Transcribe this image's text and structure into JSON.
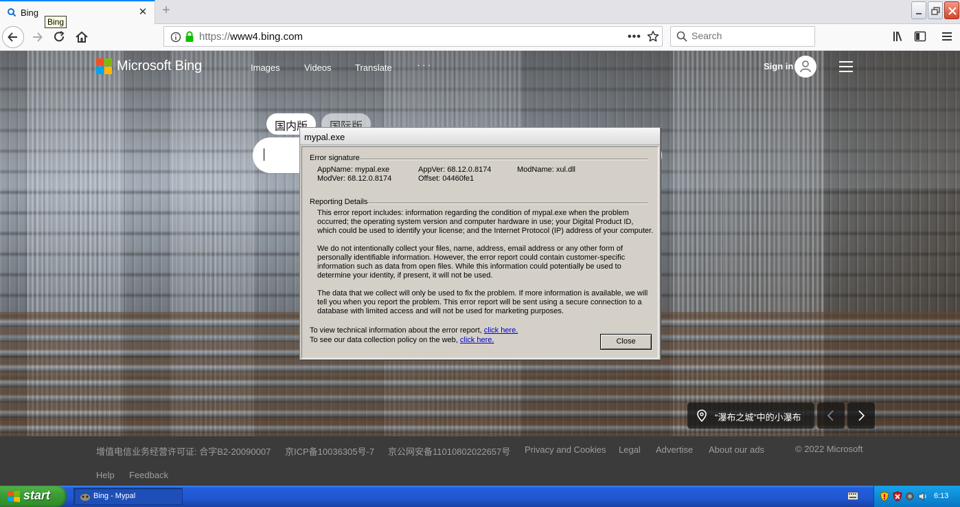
{
  "browser": {
    "tab": {
      "title": "Bing",
      "tooltip": "Bing"
    },
    "url": {
      "scheme": "https://",
      "host": "www4.bing.com"
    },
    "search": {
      "placeholder": "Search"
    }
  },
  "bing": {
    "logo_text": "Microsoft Bing",
    "nav": [
      "Images",
      "Videos",
      "Translate",
      "· · ·"
    ],
    "signin": "Sign in",
    "edition_tabs": [
      "国内版",
      "国际版"
    ],
    "caption": "“瀑布之城”中的小瀑布",
    "footer": {
      "row1": [
        "增值电信业务经营许可证: 合字B2-20090007",
        "京ICP备10036305号-7",
        "京公网安备11010802022657号",
        "Privacy and Cookies",
        "Legal",
        "Advertise",
        "About our ads",
        "© 2022 Microsoft"
      ],
      "row2": [
        "Help",
        "Feedback"
      ]
    }
  },
  "dialog": {
    "title": "mypal.exe",
    "error_signature_label": "Error signature",
    "sig": {
      "appname": "AppName: mypal.exe",
      "appver": "AppVer: 68.12.0.8174",
      "modname": "ModName: xul.dll",
      "modver": "ModVer: 68.12.0.8174",
      "offset": "Offset: 04460fe1"
    },
    "reporting_label": "Reporting Details",
    "para1": "This error report includes: information regarding the condition of mypal.exe when the problem occurred; the operating system version and computer hardware in use; your Digital Product ID, which could be used to identify your license; and the Internet Protocol (IP) address of your computer.",
    "para2": "We do not intentionally collect your files, name, address, email address or any other form of personally identifiable information. However, the error report could contain customer-specific information such as data from open files. While this information could potentially be used to determine your identity, if present, it will not be used.",
    "para3": "The data that we collect will only be used to fix the problem. If more information is available, we will tell you when you report the problem. This error report will be sent using a secure connection to a database with limited access and will not be used for marketing purposes.",
    "tech_line": "To view technical information about the error report,",
    "policy_line": "To see our data collection policy on the web,",
    "link_text": "click here.",
    "close_label": "Close"
  },
  "taskbar": {
    "start_label": "start",
    "task_item": "Bing - Mypal",
    "clock": "6:13"
  },
  "colors": {
    "accent_tab": "#0a84ff",
    "taskbar_blue": "#245edb",
    "start_green": "#3c9e36",
    "dialog_gray": "#d4d0c8",
    "link_blue": "#0000cc"
  }
}
